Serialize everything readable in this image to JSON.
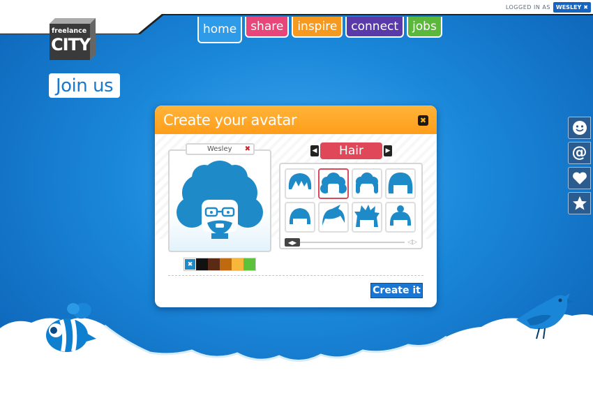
{
  "header": {
    "logged_in_label": "LOGGED IN AS",
    "username": "WESLEY",
    "logo": "freelance city"
  },
  "nav": [
    {
      "label": "home",
      "color": "#2d9be8"
    },
    {
      "label": "share",
      "color": "#e8457a"
    },
    {
      "label": "inspire",
      "color": "#f59a1e"
    },
    {
      "label": "connect",
      "color": "#5a3aa8"
    },
    {
      "label": "jobs",
      "color": "#5cb83a"
    }
  ],
  "page_title": "Join us",
  "side_icons": [
    "smiley-icon",
    "at-icon",
    "heart-icon",
    "star-icon"
  ],
  "modal": {
    "title": "Create your avatar",
    "avatar_name": "Wesley",
    "category": "Hair",
    "create_button": "Create it",
    "hair_color": "#1e8bc8",
    "swatch_colors": [
      "#1e8bc8",
      "#111111",
      "#5a2a14",
      "#c06a10",
      "#f7b73a",
      "#5cc23a"
    ],
    "hair_options": [
      "hair-1",
      "hair-2-afro",
      "hair-3",
      "hair-4",
      "hair-5",
      "hair-6",
      "hair-7",
      "hair-8"
    ],
    "selected_hair_index": 1
  },
  "colors": {
    "accent_orange": "#ff9d1a",
    "accent_blue": "#1976d2",
    "category_red": "#e0485a"
  }
}
